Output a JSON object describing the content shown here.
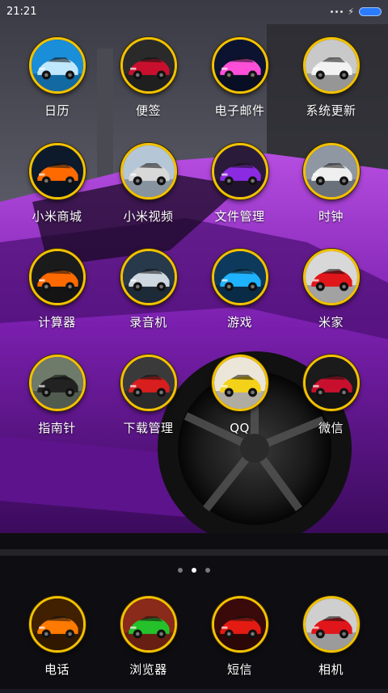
{
  "status_bar": {
    "time": "21:21",
    "battery_color": "#2b7bff"
  },
  "apps": [
    {
      "label": "日历",
      "icon": "calendar-icon",
      "car": "#bfe8ff",
      "bg": "#1a8ed8"
    },
    {
      "label": "便签",
      "icon": "notes-icon",
      "car": "#c8102e",
      "bg": "#2a2a2a"
    },
    {
      "label": "电子邮件",
      "icon": "email-icon",
      "car": "#ff4fd8",
      "bg": "#0b1330"
    },
    {
      "label": "系统更新",
      "icon": "system-update-icon",
      "car": "#f2f2f2",
      "bg": "#c9c9c9"
    },
    {
      "label": "小米商城",
      "icon": "mi-store-icon",
      "car": "#ff6a00",
      "bg": "#0d1a2b"
    },
    {
      "label": "小米视频",
      "icon": "mi-video-icon",
      "car": "#d8d8d8",
      "bg": "#b5c6d6"
    },
    {
      "label": "文件管理",
      "icon": "file-manager-icon",
      "car": "#8a2be2",
      "bg": "#2a1b3a"
    },
    {
      "label": "时钟",
      "icon": "clock-icon",
      "car": "#efefef",
      "bg": "#8f97a3"
    },
    {
      "label": "计算器",
      "icon": "calculator-icon",
      "car": "#ff6a00",
      "bg": "#1b1b1b"
    },
    {
      "label": "录音机",
      "icon": "recorder-icon",
      "car": "#cfd8e0",
      "bg": "#27394a"
    },
    {
      "label": "游戏",
      "icon": "game-icon",
      "car": "#1fb3ff",
      "bg": "#0d3a5c"
    },
    {
      "label": "米家",
      "icon": "mi-home-icon",
      "car": "#e0161b",
      "bg": "#d8d8d8"
    },
    {
      "label": "指南针",
      "icon": "compass-icon",
      "car": "#222222",
      "bg": "#6e7a6a"
    },
    {
      "label": "下载管理",
      "icon": "download-manager-icon",
      "car": "#d81e1e",
      "bg": "#3a3a3a"
    },
    {
      "label": "QQ",
      "icon": "qq-icon",
      "car": "#f5d21a",
      "bg": "#ece6d8"
    },
    {
      "label": "微信",
      "icon": "wechat-icon",
      "car": "#c8102e",
      "bg": "#1b1b1b"
    }
  ],
  "page_indicator": {
    "pages": 3,
    "active": 1
  },
  "dock": [
    {
      "label": "电话",
      "icon": "phone-icon",
      "car": "#ff7a00",
      "bg": "#402000"
    },
    {
      "label": "浏览器",
      "icon": "browser-icon",
      "car": "#25c12b",
      "bg": "#8a2a1a"
    },
    {
      "label": "短信",
      "icon": "messages-icon",
      "car": "#e31b12",
      "bg": "#3a0a0a"
    },
    {
      "label": "相机",
      "icon": "camera-icon",
      "car": "#e0161b",
      "bg": "#cfcfcf"
    }
  ]
}
